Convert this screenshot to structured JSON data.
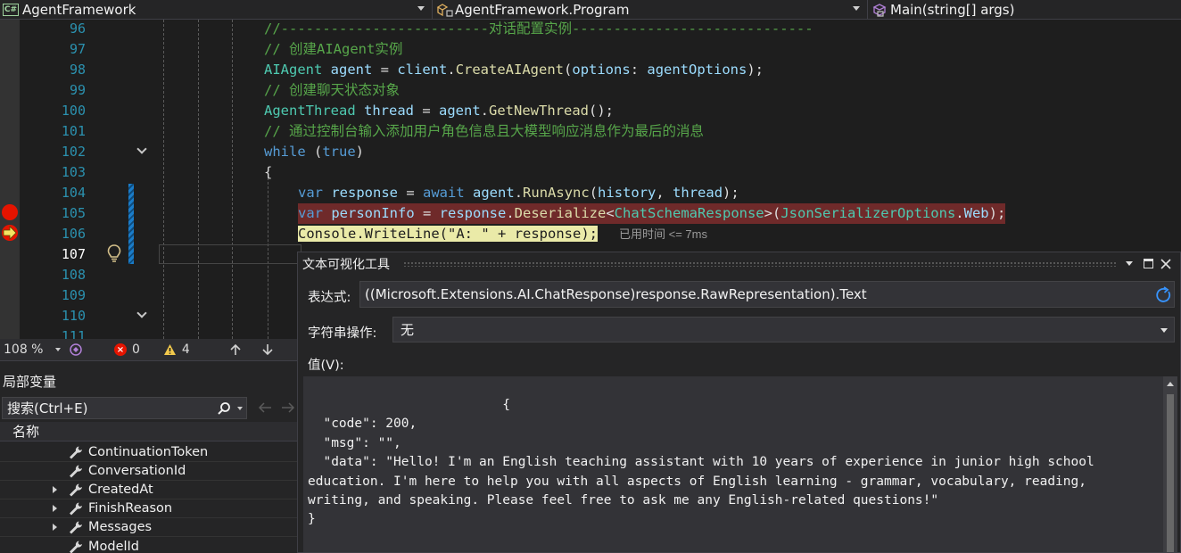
{
  "navigation": {
    "project": "AgentFramework",
    "class": "AgentFramework.Program",
    "member": "Main(string[] args)",
    "project_badge": "C#"
  },
  "editor": {
    "line_numbers": [
      "96",
      "97",
      "98",
      "99",
      "100",
      "101",
      "102",
      "103",
      "104",
      "105",
      "106",
      "107",
      "108",
      "109",
      "110",
      "111"
    ],
    "current_line": "107",
    "lines": {
      "l96_comment": "//-------------------------对话配置实例-----------------------------",
      "l97_comment": "// 创建AIAgent实例",
      "l98": {
        "type": "AIAgent",
        "var": "agent",
        "eq": " = ",
        "obj": "client",
        "dot": ".",
        "method": "CreateAIAgent",
        "open": "(",
        "param": "options",
        "colon": ": ",
        "arg": "agentOptions",
        "close": ");"
      },
      "l99_comment": "// 创建聊天状态对象",
      "l100": {
        "type": "AgentThread",
        "var": "thread",
        "eq": " = ",
        "obj": "agent",
        "dot": ".",
        "method": "GetNewThread",
        "close": "();"
      },
      "l101_comment": "// 通过控制台输入添加用户角色信息且大模型响应消息作为最后的消息",
      "l102": {
        "kw": "while",
        "open": " (",
        "val": "true",
        "close": ")"
      },
      "l103": "{",
      "l104": {
        "kw": "var",
        "var": "response",
        "eq": " = ",
        "await": "await",
        "obj": "agent",
        "dot": ".",
        "method": "RunAsync",
        "open": "(",
        "a1": "history",
        "comma": ", ",
        "a2": "thread",
        "close": ");"
      },
      "l105": {
        "kw": "var",
        "var": "personInfo",
        "eq": " = ",
        "obj": "response",
        "dot": ".",
        "method": "Deserialize",
        "lt": "<",
        "generic": "ChatSchemaResponse",
        "gt": ">(",
        "type2": "JsonSerializerOptions",
        "dot2": ".",
        "prop": "Web",
        "close": ");"
      },
      "l106": {
        "type": "Console",
        "dot": ".",
        "method": "WriteLine",
        "open": "(",
        "str": "\"A: \"",
        "plus": " + ",
        "var": "response",
        "close": ");"
      },
      "elapsed_hint": "已用时间 <= 7ms"
    }
  },
  "status": {
    "zoom": "108 %",
    "errors": "0",
    "warnings": "4"
  },
  "locals": {
    "title": "局部变量",
    "search_placeholder": "搜索(Ctrl+E)",
    "column_name": "名称",
    "items": [
      "ContinuationToken",
      "ConversationId",
      "CreatedAt",
      "FinishReason",
      "Messages",
      "ModelId"
    ]
  },
  "visualizer": {
    "title": "文本可视化工具",
    "expression_label": "表达式:",
    "expression": "((Microsoft.Extensions.AI.ChatResponse)response.RawRepresentation).Text",
    "string_op_label": "字符串操作:",
    "string_op_value": "无",
    "value_label": "值(V):",
    "value_text": "                         {\n  \"code\": 200,\n  \"msg\": \"\",\n  \"data\": \"Hello! I'm an English teaching assistant with 10 years of experience in junior high school\neducation. I'm here to help you with all aspects of English learning - grammar, vocabulary, reading,\nwriting, and speaking. Please feel free to ask me any English-related questions!\"\n}"
  },
  "colors": {
    "breakpoint": "#e51400",
    "breakpoint_line": "#6f2a2a",
    "current_line": "#eaeaa8",
    "change_bar": "#1a7cc9"
  }
}
